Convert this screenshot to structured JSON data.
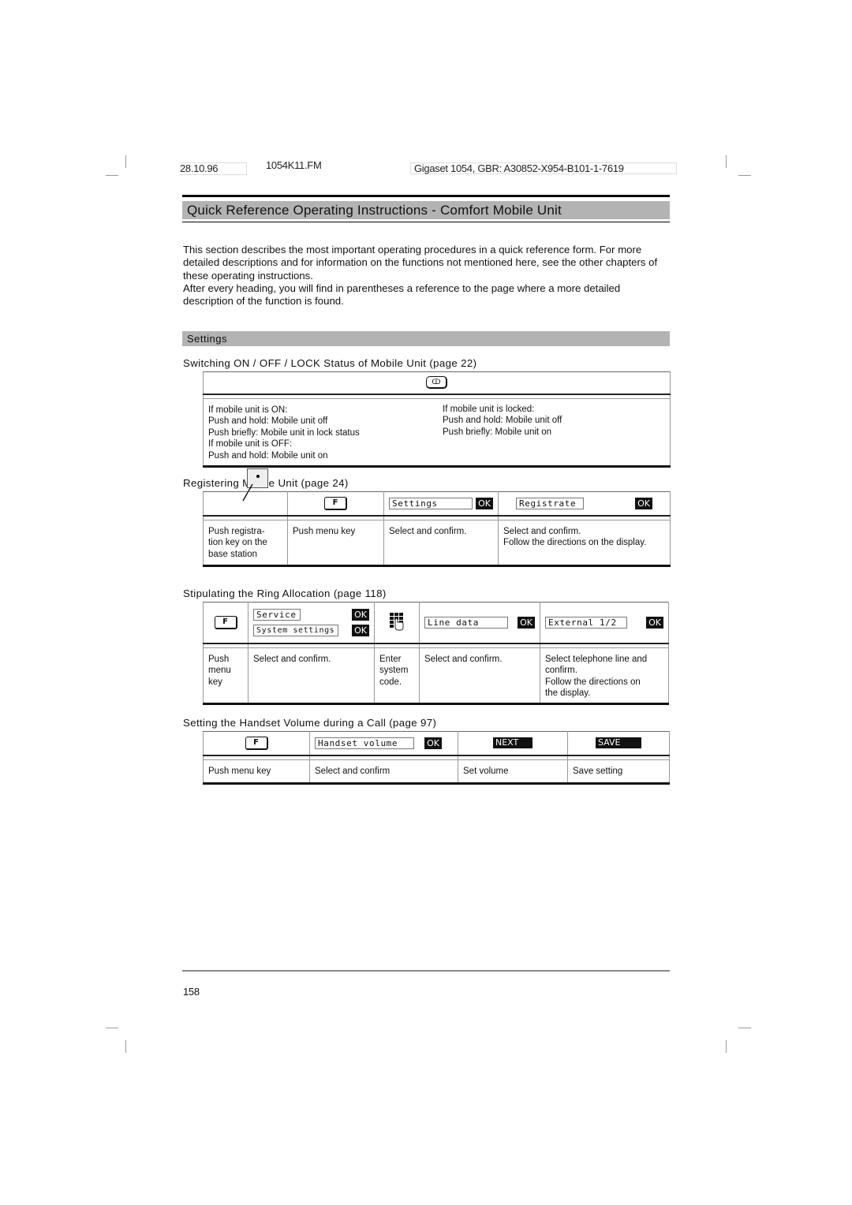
{
  "header": {
    "date": "28.10.96",
    "file": "1054K11.FM",
    "product_ref": "Gigaset 1054, GBR: A30852-X954-B101-1-7619"
  },
  "title": "Quick Reference Operating Instructions - Comfort Mobile Unit",
  "intro": {
    "p1": "This section describes the most important operating procedures in a quick reference form. For more detailed descriptions and for information on the functions not mentioned here, see the other chapters of these operating instructions.",
    "p2": "After every heading, you will find in parentheses a reference to the page where a more detailed description of the function is found."
  },
  "section": "Settings",
  "onoff": {
    "heading": "Switching ON / OFF / LOCK Status of Mobile Unit (page 22)",
    "key_icon": "power-key-icon",
    "key_glyph": "ↀ",
    "left": [
      "If mobile unit is ON:",
      "Push and hold: Mobile unit off",
      "Push briefly: Mobile unit in lock status",
      "If mobile unit is OFF:",
      "Push and hold: Mobile unit on"
    ],
    "right": [
      "If mobile unit is locked:",
      "Push and hold: Mobile unit off",
      "Push briefly: Mobile unit on"
    ]
  },
  "register": {
    "heading": "Registering Mobile Unit (page 24)",
    "fkey": "F",
    "lcd1": "Settings",
    "lcd2": "Registrate",
    "ok": "OK",
    "desc": [
      [
        "Push registra-",
        "tion key on the",
        "base station"
      ],
      [
        "Push menu key"
      ],
      [
        "Select and confirm."
      ],
      [
        "Select and confirm.",
        "Follow the directions on the display."
      ]
    ]
  },
  "ring": {
    "heading": "Stipulating the Ring Allocation (page 118)",
    "fkey": "F",
    "lcd_service": "Service",
    "lcd_system": "System settings",
    "lcd_line": "Line data",
    "lcd_external": "External 1/2",
    "ok": "OK",
    "desc": [
      [
        "Push",
        "menu",
        "key"
      ],
      [
        "Select and confirm."
      ],
      [
        "Enter",
        "system",
        "code."
      ],
      [
        "Select and confirm."
      ],
      [
        "Select telephone line and",
        "confirm.",
        "Follow the directions on",
        "the display."
      ]
    ]
  },
  "volume": {
    "heading": "Setting the Handset Volume during a Call (page 97)",
    "fkey": "F",
    "lcd": "Handset volume",
    "ok": "OK",
    "next": "NEXT",
    "save": "SAVE",
    "desc": [
      "Push menu key",
      "Select and confirm",
      "Set volume",
      "Save setting"
    ]
  },
  "page_number": "158"
}
